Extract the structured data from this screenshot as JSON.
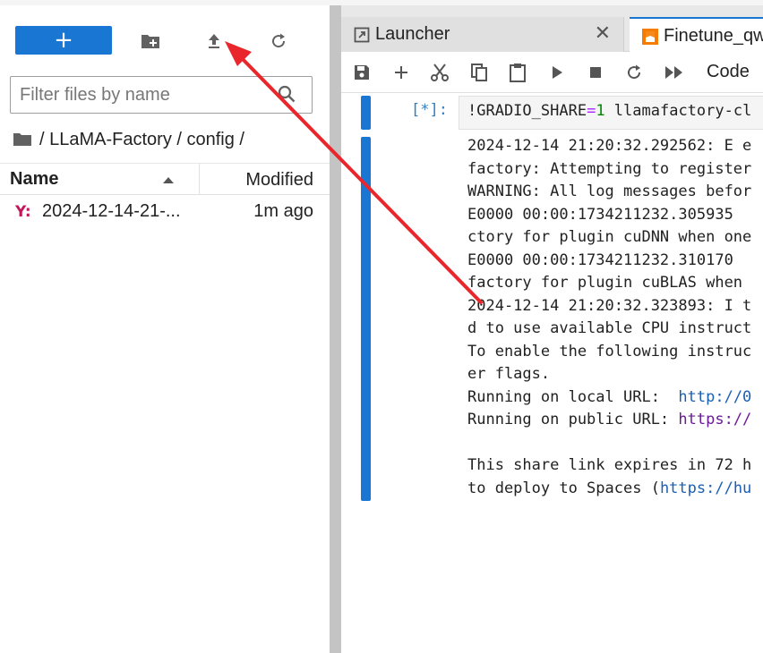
{
  "file_browser": {
    "new_button_label": "+",
    "filter_placeholder": "Filter files by name",
    "breadcrumb": "/ LLaMA-Factory / config /",
    "columns": {
      "name": "Name",
      "modified": "Modified"
    },
    "files": [
      {
        "icon": "yaml-file-icon",
        "icon_text": "Y:",
        "name": "2024-12-14-21-...",
        "modified": "1m ago"
      }
    ]
  },
  "tabs": [
    {
      "label": "Launcher",
      "icon": "launcher-icon"
    },
    {
      "label": "Finetune_qw",
      "icon": "notebook-icon"
    }
  ],
  "notebook_toolbar": {
    "cell_type": "Code"
  },
  "cell": {
    "prompt": "[*]:",
    "input_parts": {
      "a": "!GRADIO_SHARE",
      "eq": "=",
      "num": "1",
      "rest": " llamafactory-cl"
    },
    "output_lines": [
      "2024-12-14 21:20:32.292562: E e",
      "factory: Attempting to register",
      "WARNING: All log messages befor",
      "E0000 00:00:1734211232.305935",
      "ctory for plugin cuDNN when one",
      "E0000 00:00:1734211232.310170",
      "factory for plugin cuBLAS when",
      "2024-12-14 21:20:32.323893: I t",
      "d to use available CPU instruct",
      "To enable the following instruc",
      "er flags."
    ],
    "local_url_label": "Running on local URL:  ",
    "local_url": "http://0",
    "public_url_label": "Running on public URL: ",
    "public_url": "https://",
    "expire_line": "This share link expires in 72 h",
    "deploy_prefix": "to deploy to Spaces (",
    "deploy_url": "https://hu"
  },
  "colors": {
    "accent": "#1976d2",
    "annotation_arrow": "#e8262b",
    "yaml_icon": "#c2185b"
  }
}
